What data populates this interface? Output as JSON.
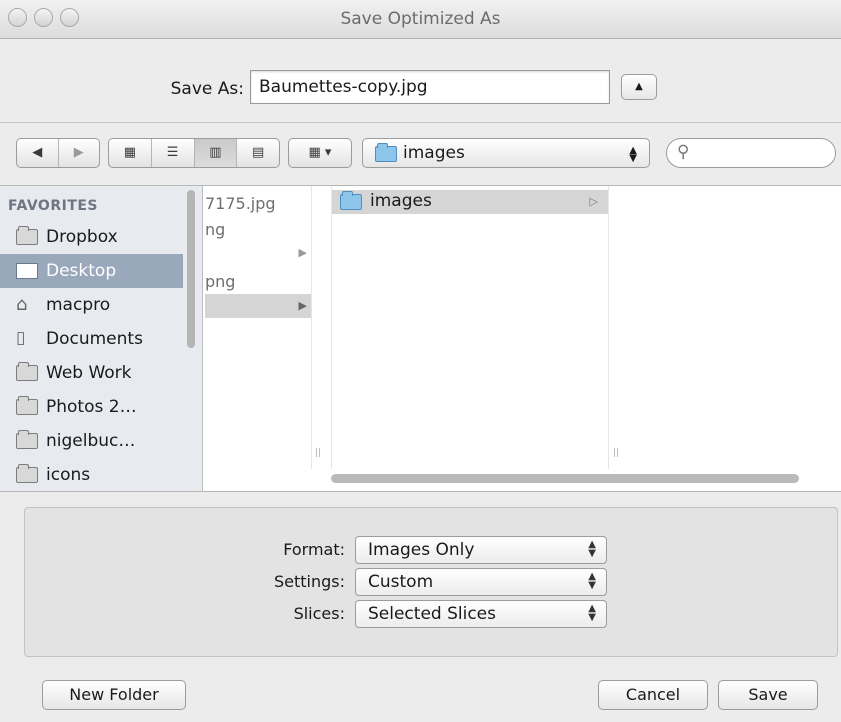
{
  "window": {
    "title": "Save Optimized As"
  },
  "save_as": {
    "label": "Save As:",
    "value": "Baumettes-copy.jpg"
  },
  "toolbar": {
    "current_folder": "images",
    "search_placeholder": ""
  },
  "sidebar": {
    "heading": "FAVORITES",
    "items": [
      {
        "label": "Dropbox",
        "icon": "folder-icon"
      },
      {
        "label": "Desktop",
        "icon": "desktop-icon",
        "selected": true
      },
      {
        "label": "macpro",
        "icon": "home-icon"
      },
      {
        "label": "Documents",
        "icon": "documents-icon"
      },
      {
        "label": "Web Work",
        "icon": "folder-icon"
      },
      {
        "label": "Photos 2…",
        "icon": "folder-icon"
      },
      {
        "label": "nigelbuc…",
        "icon": "folder-icon"
      },
      {
        "label": "icons",
        "icon": "folder-icon"
      }
    ]
  },
  "browser": {
    "col1_items": [
      "7175.jpg",
      "ng",
      "",
      "png",
      ""
    ],
    "col2_items": [
      {
        "label": "images",
        "selected": true
      }
    ]
  },
  "options": {
    "format_label": "Format:",
    "format_value": "Images Only",
    "settings_label": "Settings:",
    "settings_value": "Custom",
    "slices_label": "Slices:",
    "slices_value": "Selected Slices"
  },
  "buttons": {
    "new_folder": "New Folder",
    "cancel": "Cancel",
    "save": "Save"
  }
}
